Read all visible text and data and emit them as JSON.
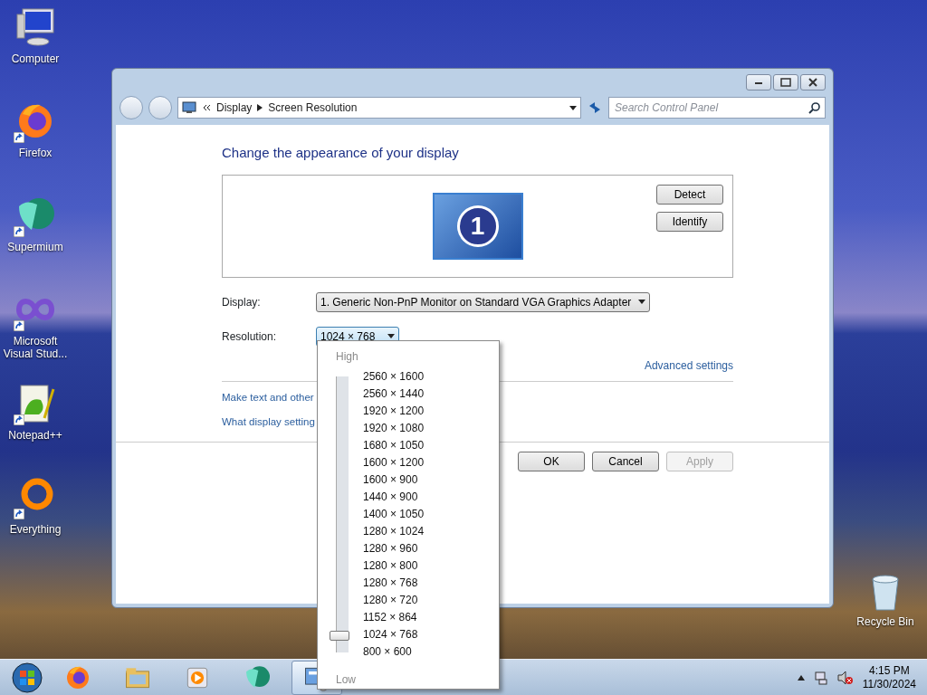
{
  "desktop_icons": [
    {
      "label": "Computer",
      "kind": "computer",
      "shortcut": false
    },
    {
      "label": "Firefox",
      "kind": "firefox",
      "shortcut": true
    },
    {
      "label": "Supermium",
      "kind": "supermium",
      "shortcut": true
    },
    {
      "label": "Microsoft Visual Stud...",
      "kind": "infinity",
      "shortcut": true
    },
    {
      "label": "Notepad++",
      "kind": "notepad",
      "shortcut": true
    },
    {
      "label": "Everything",
      "kind": "ring",
      "shortcut": true
    }
  ],
  "recycle_bin": {
    "label": "Recycle Bin"
  },
  "window": {
    "breadcrumb": [
      "Display",
      "Screen Resolution"
    ],
    "search": {
      "placeholder": "Search Control Panel"
    },
    "heading": "Change the appearance of your display",
    "monitor_number": "1",
    "side_buttons": [
      "Detect",
      "Identify"
    ],
    "display": {
      "label": "Display:",
      "value": "1. Generic Non-PnP Monitor on Standard VGA Graphics Adapter"
    },
    "resolution": {
      "label": "Resolution:",
      "value": "1024 × 768",
      "expanded": true
    },
    "advanced_link": "Advanced settings",
    "links": [
      "Make text and other",
      "What display setting"
    ],
    "buttons": [
      {
        "label": "OK",
        "disabled": false
      },
      {
        "label": "Cancel",
        "disabled": false
      },
      {
        "label": "Apply",
        "disabled": true
      }
    ],
    "resolution_menu": {
      "high_label": "High",
      "low_label": "Low",
      "level": 0.0625,
      "options": [
        "2560 × 1600",
        "2560 × 1440",
        "1920 × 1200",
        "1920 × 1080",
        "1680 × 1050",
        "1600 × 1200",
        "1600 × 900",
        "1440 × 900",
        "1400 × 1050",
        "1280 × 1024",
        "1280 × 960",
        "1280 × 800",
        "1280 × 768",
        "1280 × 720",
        "1152 × 864",
        "1024 × 768",
        "800 × 600"
      ]
    }
  },
  "taskbar": {
    "apps": [
      {
        "kind": "firefox",
        "active": false
      },
      {
        "kind": "folder",
        "active": false
      },
      {
        "kind": "media",
        "active": false
      },
      {
        "kind": "supermium",
        "active": false
      },
      {
        "kind": "control-panel",
        "active": true
      }
    ],
    "clock": {
      "time": "4:15 PM",
      "date": "11/30/2024"
    }
  }
}
